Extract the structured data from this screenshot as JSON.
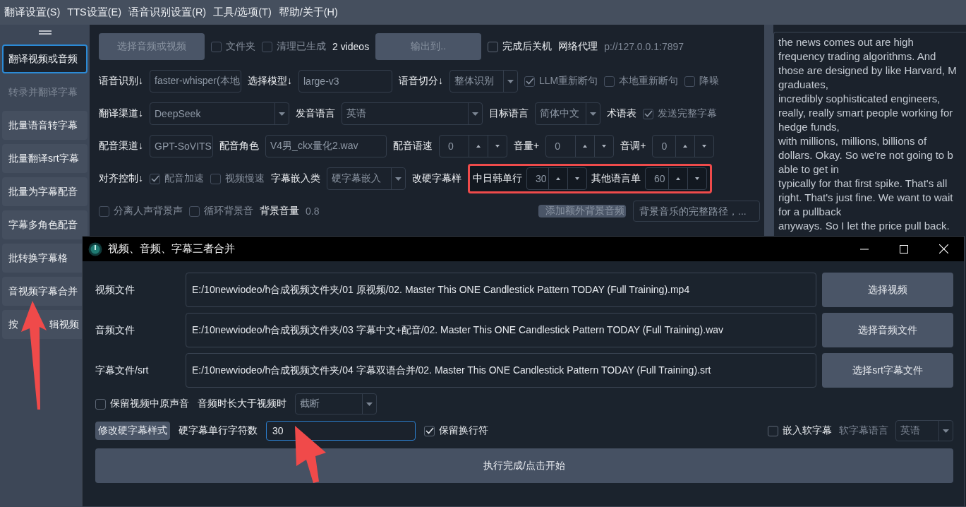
{
  "menu": [
    "翻译设置(S)",
    "TTS设置(E)",
    "语音识别设置(R)",
    "工具/选项(T)",
    "帮助/关于(H)"
  ],
  "sidebar": {
    "items": [
      {
        "label": "翻译视频或音频",
        "selected": true,
        "disabled": false
      },
      {
        "label": "转录并翻译字幕",
        "selected": false,
        "disabled": true
      },
      {
        "label": "批量语音转字幕",
        "selected": false,
        "disabled": false
      },
      {
        "label": "批量翻译srt字幕",
        "selected": false,
        "disabled": false
      },
      {
        "label": "批量为字幕配音",
        "selected": false,
        "disabled": false
      },
      {
        "label": "字幕多角色配音",
        "selected": false,
        "disabled": false
      },
      {
        "label": "批转换字幕格",
        "selected": false,
        "disabled": false
      },
      {
        "label": "音视频字幕合并",
        "selected": false,
        "disabled": false
      },
      {
        "label": "按",
        "label_after": "辑视频",
        "selected": false,
        "disabled": false
      }
    ]
  },
  "main": {
    "rows": [
      {
        "items": [
          {
            "kind": "button",
            "text": "选择音频或视频",
            "disabled": true
          },
          {
            "kind": "checkbox",
            "text": "文件夹",
            "checked": false,
            "disabled": true
          },
          {
            "kind": "checkbox",
            "text": "清理已生成",
            "checked": false,
            "disabled": true
          },
          {
            "kind": "text",
            "text": "2 videos"
          },
          {
            "kind": "button",
            "text": "输出到..",
            "disabled": true
          },
          {
            "kind": "checkbox",
            "text": "完成后关机",
            "checked": false,
            "disabled": false
          },
          {
            "kind": "label",
            "text": "网络代理"
          },
          {
            "kind": "text",
            "text": "p://127.0.0.1:7897",
            "disabled": true
          }
        ]
      },
      {
        "items": [
          {
            "kind": "label",
            "text": "语音识别↓"
          },
          {
            "kind": "field",
            "value": "faster-whisper(本地"
          },
          {
            "kind": "label",
            "text": "选择模型↓"
          },
          {
            "kind": "field",
            "value": "large-v3"
          },
          {
            "kind": "label",
            "text": "语音切分↓"
          },
          {
            "kind": "combo",
            "value": "整体识别"
          },
          {
            "kind": "checkbox",
            "text": "LLM重新断句",
            "checked": true,
            "disabled": true
          },
          {
            "kind": "checkbox",
            "text": "本地重新断句",
            "checked": false,
            "disabled": true
          },
          {
            "kind": "checkbox",
            "text": "降噪",
            "checked": false,
            "disabled": true
          }
        ]
      },
      {
        "items": [
          {
            "kind": "label",
            "text": "翻译渠道↓"
          },
          {
            "kind": "combo",
            "value": "DeepSeek"
          },
          {
            "kind": "label",
            "text": "发音语言"
          },
          {
            "kind": "combo",
            "value": "英语"
          },
          {
            "kind": "label",
            "text": "目标语言"
          },
          {
            "kind": "combo",
            "value": "简体中文"
          },
          {
            "kind": "label",
            "text": "术语表"
          },
          {
            "kind": "checkbox",
            "text": "发送完整字幕",
            "checked": true,
            "disabled": true
          }
        ]
      },
      {
        "items": [
          {
            "kind": "label",
            "text": "配音渠道↓"
          },
          {
            "kind": "field",
            "value": "GPT-SoVITS"
          },
          {
            "kind": "label",
            "text": "配音角色"
          },
          {
            "kind": "field",
            "value": "V4男_ckx量化2.wav"
          },
          {
            "kind": "label",
            "text": "配音语速"
          },
          {
            "kind": "spin",
            "value": "0"
          },
          {
            "kind": "label",
            "text": "音量+"
          },
          {
            "kind": "spin",
            "value": "0"
          },
          {
            "kind": "label",
            "text": "音调+"
          },
          {
            "kind": "spin",
            "value": "0"
          }
        ]
      },
      {
        "items": [
          {
            "kind": "label",
            "text": "对齐控制↓"
          },
          {
            "kind": "checkbox",
            "text": "配音加速",
            "checked": true,
            "disabled": true
          },
          {
            "kind": "checkbox",
            "text": "视频慢速",
            "checked": false,
            "disabled": true
          },
          {
            "kind": "label",
            "text": "字幕嵌入类"
          },
          {
            "kind": "combo",
            "value": "硬字幕嵌入"
          },
          {
            "kind": "label",
            "text": "改硬字幕样"
          }
        ],
        "highlight": [
          {
            "kind": "label",
            "text": "中日韩单行"
          },
          {
            "kind": "spin",
            "value": "30"
          },
          {
            "kind": "label",
            "text": "其他语言单"
          },
          {
            "kind": "spin",
            "value": "60"
          }
        ]
      },
      {
        "items": [
          {
            "kind": "checkbox",
            "text": "分离人声背景声",
            "checked": false,
            "disabled": true
          },
          {
            "kind": "checkbox",
            "text": "循环背景音",
            "checked": false,
            "disabled": true
          },
          {
            "kind": "label",
            "text": "背景音量"
          },
          {
            "kind": "text",
            "text": "0.8",
            "disabled": true
          }
        ],
        "right": [
          {
            "kind": "button",
            "text": "添加额外背景音频",
            "disabled": true
          },
          {
            "kind": "input",
            "placeholder": "背景音乐的完整路径，..."
          }
        ]
      }
    ]
  },
  "log": {
    "lines": [
      "the news comes out are high",
      "frequency trading algorithms. And",
      "those are designed by like Harvard, M",
      "graduates,",
      "incredibly sophisticated engineers,",
      "really, really smart people working for",
      "hedge funds,",
      "with millions, millions, billions of",
      "dollars. Okay. So we're not going to b",
      "able to get in",
      "typically for that first spike. That's all",
      "right. That's just fine. We want to wait",
      "for a pullback",
      "anyways. So I let the price pull back."
    ]
  },
  "dialog": {
    "title": "视频、音频、字幕三者合并",
    "files": [
      {
        "label": "视频文件",
        "value": "E:/10newviodeo/h合成视频文件夹/01 原视频/02. Master This ONE Candlestick Pattern TODAY (Full Training).mp4",
        "button": "选择视频"
      },
      {
        "label": "音频文件",
        "value": "E:/10newviodeo/h合成视频文件夹/03 字幕中文+配音/02. Master This ONE Candlestick Pattern TODAY (Full Training).wav",
        "button": "选择音频文件"
      },
      {
        "label": "字幕文件/srt",
        "value": "E:/10newviodeo/h合成视频文件夹/04 字幕双语合并/02. Master This ONE Candlestick Pattern TODAY (Full Training).srt",
        "button": "选择srt字幕文件"
      }
    ],
    "options": [
      {
        "items": [
          {
            "kind": "checkbox",
            "text": "保留视频中原声音",
            "checked": false,
            "disabled": false
          },
          {
            "kind": "label",
            "text": "音频时长大于视频时"
          },
          {
            "kind": "combo",
            "value": "截断"
          }
        ]
      },
      {
        "items": [
          {
            "kind": "button",
            "text": "修改硬字幕样式",
            "disabled": false,
            "small": true
          },
          {
            "kind": "label",
            "text": "硬字幕单行字符数"
          },
          {
            "kind": "input",
            "value": "30",
            "focused": true
          },
          {
            "kind": "checkbox",
            "text": "保留换行符",
            "checked": true,
            "disabled": false
          }
        ],
        "right": [
          {
            "kind": "checkbox",
            "text": "嵌入软字幕",
            "checked": false,
            "disabled": false
          },
          {
            "kind": "label",
            "text": "软字幕语言",
            "disabled": true
          },
          {
            "kind": "combo",
            "value": "英语",
            "disabled": true
          }
        ]
      }
    ],
    "start_button": "执行完成/点击开始"
  }
}
